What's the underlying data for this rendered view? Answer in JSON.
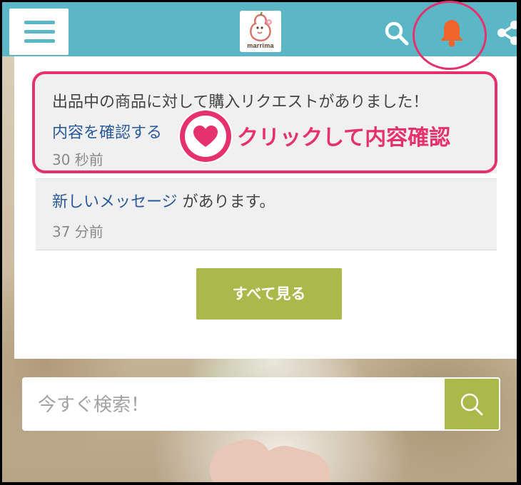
{
  "header": {
    "logo_text": "marrima",
    "icons": {
      "menu": "hamburger-menu-icon",
      "search": "search-icon",
      "bell": "bell-icon",
      "share": "share-icon"
    }
  },
  "notifications": [
    {
      "text": "出品中の商品に対して購入リクエストがありました！",
      "link": "内容を確認する",
      "time": "30 秒前"
    },
    {
      "link": "新しいメッセージ",
      "text": " があります。",
      "time": "37 分前"
    }
  ],
  "annotation": {
    "label": "クリックして内容確認",
    "icon": "heart-icon"
  },
  "see_all_label": "すべて見る",
  "search": {
    "placeholder": "今すぐ検索！",
    "icon": "search-icon"
  },
  "colors": {
    "header": "#5bb7c6",
    "accent_pink": "#e5326f",
    "bell": "#f0642a",
    "button_green": "#abb94a",
    "link": "#2a5a9a"
  }
}
